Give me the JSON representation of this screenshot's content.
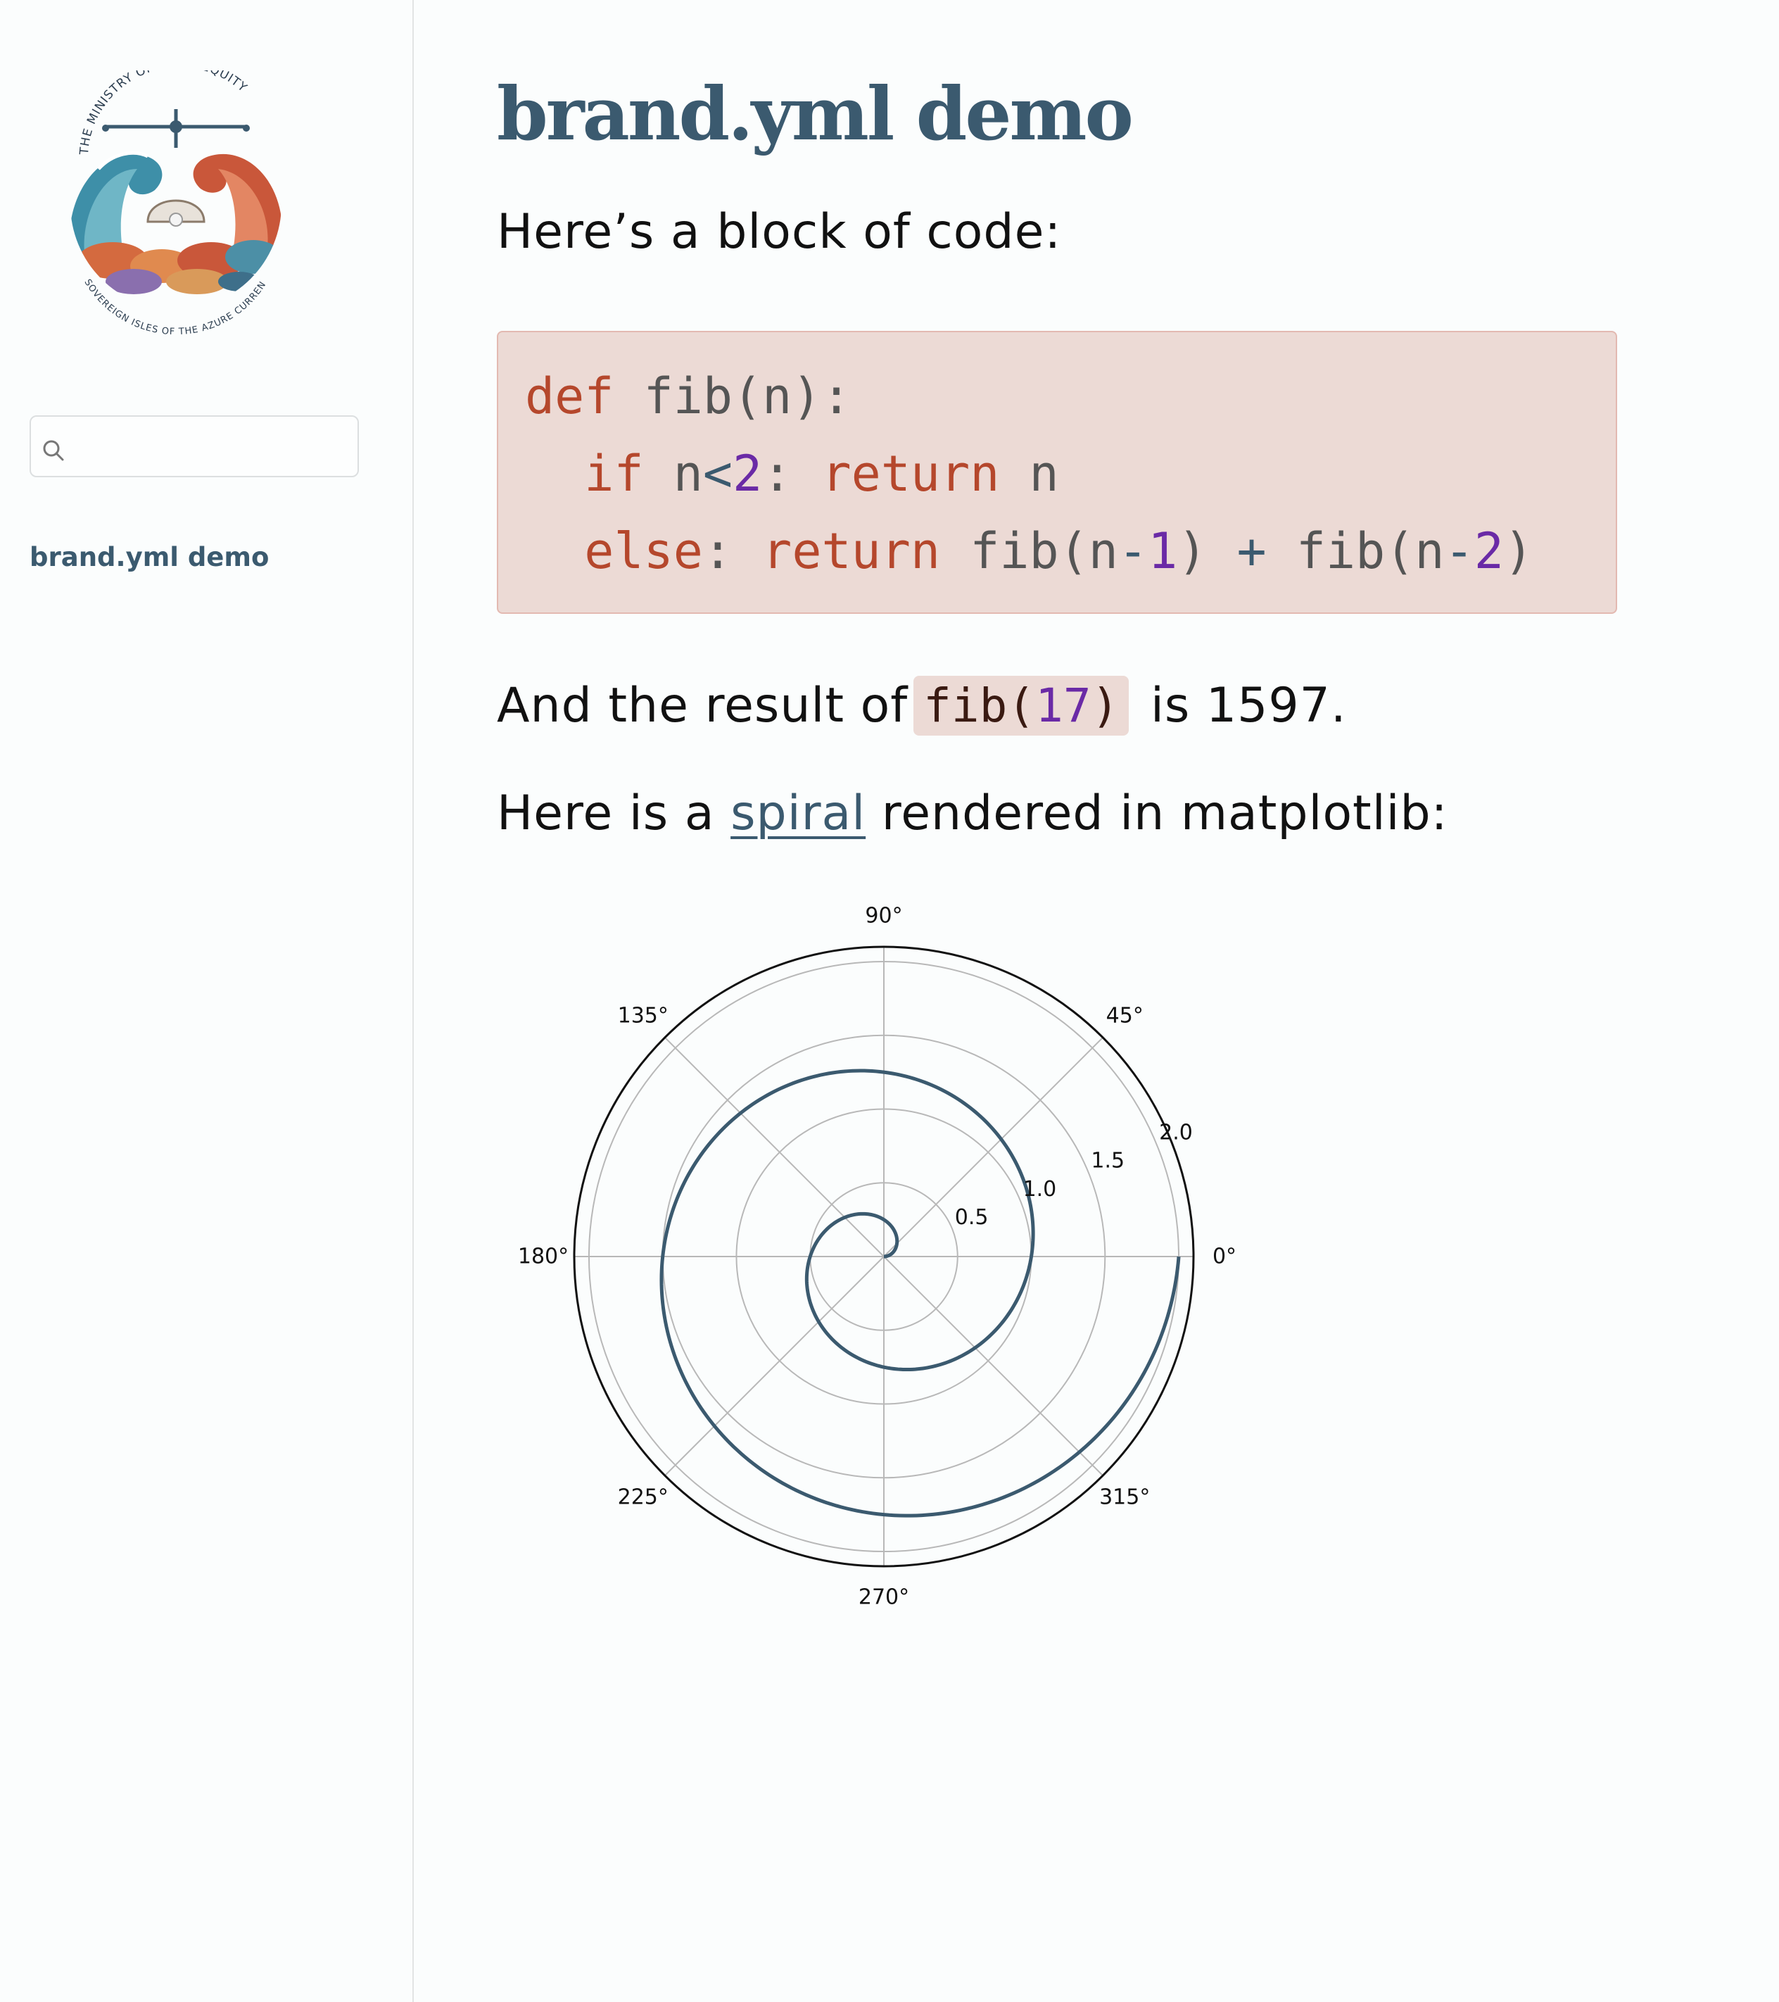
{
  "sidebar": {
    "logo": {
      "top_text": "THE MINISTRY OF TIDAL EQUITY",
      "bottom_text": "SOVEREIGN ISLES OF THE AZURE CURRENT"
    },
    "search": {
      "placeholder": "",
      "value": ""
    },
    "nav_items": [
      {
        "label": "brand.yml demo"
      }
    ]
  },
  "main": {
    "title": "brand.yml demo",
    "intro": "Here’s a block of code:",
    "code": {
      "line1": {
        "t1": "def",
        "t2": " fib(n):"
      },
      "line2": {
        "t1": "if",
        "t2": " n",
        "t3": "<",
        "t4": "2",
        "t5": ": ",
        "t6": "return",
        "t7": " n"
      },
      "line3": {
        "t1": "else",
        "t2": ": ",
        "t3": "return",
        "t4": " fib(n",
        "t5": "-",
        "t6": "1",
        "t7": ") ",
        "t8": "+",
        "t9": " fib(n",
        "t10": "-",
        "t11": "2",
        "t12": ")"
      }
    },
    "result": {
      "before": "And the result of",
      "code_fn": "fib(",
      "code_num": "17",
      "code_close": ")",
      "after": " is 1597."
    },
    "spiral_sentence": {
      "before": "Here is a ",
      "link": "spiral",
      "after": " rendered in matplotlib:"
    }
  },
  "colors": {
    "brand_primary": "#3b5a6f",
    "code_background": "#ecdad5",
    "code_keyword": "#b5472c",
    "code_number": "#6a2aa6",
    "page_background": "#fbfdfd"
  },
  "chart_data": {
    "type": "polar-line",
    "function": "r = theta / (2*pi)",
    "r_max": 2.1,
    "r_ticks": [
      0.5,
      1.0,
      1.5,
      2.0
    ],
    "r_tick_labels": [
      "0.5",
      "1.0",
      "1.5",
      "2.0"
    ],
    "r_label_angle_deg": 22.5,
    "theta_ticks_deg": [
      0,
      45,
      90,
      135,
      180,
      225,
      270,
      315
    ],
    "theta_tick_labels": [
      "0°",
      "45°",
      "90°",
      "135°",
      "180°",
      "225°",
      "270°",
      "315°"
    ],
    "grid": true,
    "series": [
      {
        "theta_start": 0,
        "theta_end": 12.566,
        "color": "#3b5a6f"
      }
    ]
  }
}
